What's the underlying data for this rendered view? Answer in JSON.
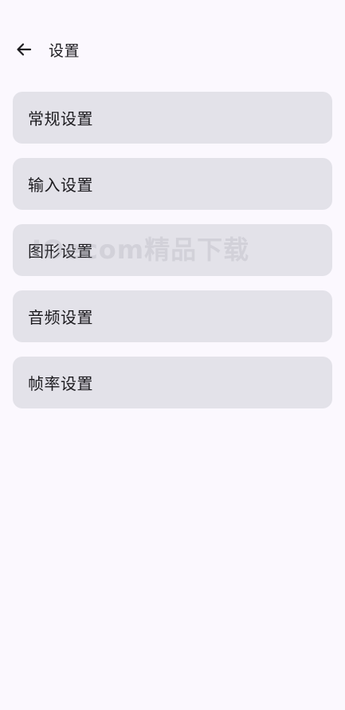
{
  "header": {
    "title": "设置",
    "back_icon": "arrow-left-icon"
  },
  "menu": {
    "items": [
      {
        "label": "常规设置"
      },
      {
        "label": "输入设置"
      },
      {
        "label": "图形设置"
      },
      {
        "label": "音频设置"
      },
      {
        "label": "帧率设置"
      }
    ]
  },
  "watermark": {
    "text": "IOecom精品下载"
  },
  "colors": {
    "background": "#fbf8fe",
    "card": "#e3e2e9",
    "text": "#1c1b1f"
  }
}
